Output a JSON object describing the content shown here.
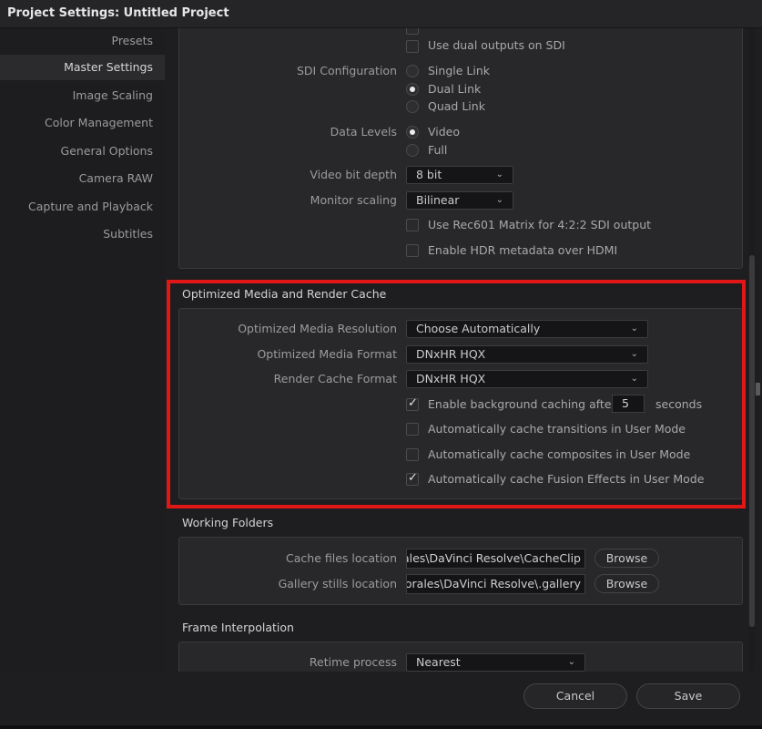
{
  "window": {
    "title": "Project Settings:  Untitled Project"
  },
  "sidebar": {
    "items": [
      {
        "label": "Presets",
        "active": false
      },
      {
        "label": "Master Settings",
        "active": true
      },
      {
        "label": "Image Scaling",
        "active": false
      },
      {
        "label": "Color Management",
        "active": false
      },
      {
        "label": "General Options",
        "active": false
      },
      {
        "label": "Camera RAW",
        "active": false
      },
      {
        "label": "Capture and Playback",
        "active": false
      },
      {
        "label": "Subtitles",
        "active": false
      }
    ]
  },
  "video_monitoring": {
    "dual_outputs_label": "Use dual outputs on SDI",
    "dual_outputs_checked": false,
    "sdi_label": "SDI Configuration",
    "sdi_options": [
      "Single Link",
      "Dual Link",
      "Quad Link"
    ],
    "sdi_selected": "Dual Link",
    "data_levels_label": "Data Levels",
    "data_levels_options": [
      "Video",
      "Full"
    ],
    "data_levels_selected": "Video",
    "bit_depth_label": "Video bit depth",
    "bit_depth_value": "8 bit",
    "monitor_scaling_label": "Monitor scaling",
    "monitor_scaling_value": "Bilinear",
    "rec601_label": "Use Rec601 Matrix for 4:2:2 SDI output",
    "rec601_checked": false,
    "hdr_label": "Enable HDR metadata over HDMI",
    "hdr_checked": false
  },
  "optimized": {
    "title": "Optimized Media and Render Cache",
    "resolution_label": "Optimized Media Resolution",
    "resolution_value": "Choose Automatically",
    "format_label": "Optimized Media Format",
    "format_value": "DNxHR HQX",
    "render_cache_label": "Render Cache Format",
    "render_cache_value": "DNxHR HQX",
    "bg_caching_label": "Enable background caching after",
    "bg_caching_checked": true,
    "bg_caching_seconds": "5",
    "seconds_label": "seconds",
    "cache_transitions_label": "Automatically cache transitions in User Mode",
    "cache_transitions_checked": false,
    "cache_composites_label": "Automatically cache composites in User Mode",
    "cache_composites_checked": false,
    "cache_fusion_label": "Automatically cache Fusion Effects in User Mode",
    "cache_fusion_checked": true
  },
  "working_folders": {
    "title": "Working Folders",
    "cache_label": "Cache files location",
    "cache_value": "C:\\Users\\jporales\\DaVinci Resolve\\CacheClip",
    "cache_value_visible": "porales\\DaVinci Resolve\\CacheClip",
    "gallery_label": "Gallery stills location",
    "gallery_value_visible": "nporales\\DaVinci Resolve\\.gallery",
    "browse_label": "Browse"
  },
  "frame_interpolation": {
    "title": "Frame Interpolation",
    "retime_label": "Retime process",
    "retime_value": "Nearest"
  },
  "footer": {
    "cancel_label": "Cancel",
    "save_label": "Save"
  },
  "colors": {
    "highlight": "#e11717",
    "accent_bg": "#1e1e20"
  }
}
